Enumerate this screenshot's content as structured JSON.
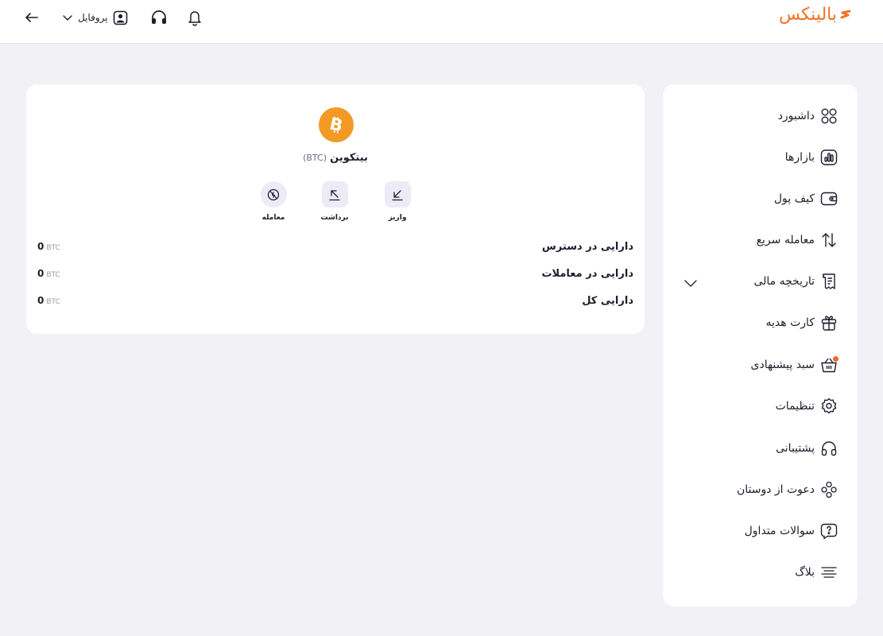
{
  "header": {
    "logo_text": "بالینکس",
    "profile_label": "پروفایل",
    "icons": [
      "back-arrow-icon",
      "chevron-down-icon",
      "user-icon",
      "headset-icon",
      "bell-icon"
    ]
  },
  "asset": {
    "name": "بیتکوین",
    "symbol": "(BTC)",
    "actions": [
      {
        "label": "واریز",
        "icon": "deposit-arrow-icon"
      },
      {
        "label": "برداشت",
        "icon": "withdraw-arrow-icon"
      },
      {
        "label": "معامله",
        "icon": "trade-icon"
      }
    ],
    "balances": [
      {
        "label": "دارایی در دسترس",
        "value": "0",
        "unit": "BTC"
      },
      {
        "label": "دارایی در معاملات",
        "value": "0",
        "unit": "BTC"
      },
      {
        "label": "دارایی کل",
        "value": "0",
        "unit": "BTC"
      }
    ]
  },
  "sidebar": {
    "items": [
      {
        "label": "داشبورد",
        "icon": "dashboard-grid-icon"
      },
      {
        "label": "بازارها",
        "icon": "markets-chart-icon"
      },
      {
        "label": "کیف پول",
        "icon": "wallet-icon"
      },
      {
        "label": "معامله سریع",
        "icon": "swap-arrows-icon"
      },
      {
        "label": "تاریخچه مالی",
        "icon": "receipt-icon"
      },
      {
        "label": "کارت هدیه",
        "icon": "gift-icon"
      },
      {
        "label": "سبد پیشنهادی",
        "icon": "basket-icon"
      },
      {
        "label": "تنظیمات",
        "icon": "gear-icon"
      },
      {
        "label": "پشتیبانی",
        "icon": "headset-icon"
      },
      {
        "label": "دعوت از دوستان",
        "icon": "users-icon"
      },
      {
        "label": "سوالات متداول",
        "icon": "faq-icon"
      },
      {
        "label": "بلاگ",
        "icon": "blog-lines-icon"
      }
    ]
  },
  "colors": {
    "brand": "#f0742a",
    "bitcoin": "#f39a25",
    "background": "#f1f1f6",
    "action_bg": "#ecebf7",
    "notification_dot": "#f26a2a"
  }
}
